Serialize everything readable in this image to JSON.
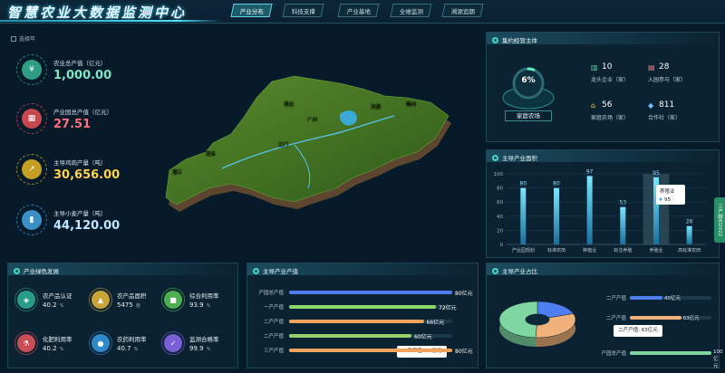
{
  "header": {
    "title": "智慧农业大数据监测中心",
    "nav": [
      "产业分布",
      "科技支撑",
      "产业基地",
      "全维监测",
      "溯源追期"
    ]
  },
  "filter": {
    "label": "选择年"
  },
  "stats": [
    {
      "label": "农业总产值（亿元）",
      "value": "1,000.00",
      "color": "#7ee7c4",
      "icon_color": "#2f9d82",
      "icon": "yuan-icon"
    },
    {
      "label": "产业园总产值（亿元）",
      "value": "27.51",
      "color": "#ff6f7d",
      "icon_color": "#c7474f",
      "icon": "building-icon"
    },
    {
      "label": "主导鸡肉产量（吨）",
      "value": "30,656.00",
      "color": "#ffd24d",
      "icon_color": "#c59e24",
      "icon": "trend-icon"
    },
    {
      "label": "主导小麦产量（吨）",
      "value": "44,120.00",
      "color": "#bfe6ff",
      "icon_color": "#3b8fc7",
      "icon": "bar-icon"
    }
  ],
  "map": {
    "cities": [
      "清远",
      "河源",
      "梅州",
      "广州",
      "江门",
      "茂名",
      "湛江"
    ]
  },
  "jiyue": {
    "title": "集约经营主体",
    "gauge_value": "6%",
    "gauge_fraction": 0.06,
    "gauge_label": "家庭农场",
    "items": [
      {
        "icon": "enterprise-icon",
        "value": "10",
        "label": "龙头企业（家）",
        "color": "#5fd3a7"
      },
      {
        "icon": "park-icon",
        "value": "28",
        "label": "入园参与（家）",
        "color": "#ff7a86"
      },
      {
        "icon": "farm-icon",
        "value": "56",
        "label": "家庭农场（家）",
        "color": "#ffcd3c"
      },
      {
        "icon": "coop-icon",
        "value": "811",
        "label": "合作社（家）",
        "color": "#6fc3ff"
      }
    ]
  },
  "mianji": {
    "title": "主导产业面积",
    "tooltip": {
      "name": "养殖业",
      "value": "95"
    }
  },
  "green": {
    "title": "产业绿色发展",
    "items": [
      {
        "icon": "shield-icon",
        "label": "农产品认证",
        "value": "40.2",
        "unit": "%",
        "color": "#2a9d8a"
      },
      {
        "icon": "area-icon",
        "label": "农产品面积",
        "value": "5475",
        "unit": "亩",
        "color": "#c9a43a"
      },
      {
        "icon": "cube-icon",
        "label": "综合利用率",
        "value": "93.9",
        "unit": "%",
        "color": "#4caf50"
      },
      {
        "icon": "flask-icon",
        "label": "化肥利用率",
        "value": "40.2",
        "unit": "%",
        "color": "#c94d55"
      },
      {
        "icon": "drop-icon",
        "label": "农药利用率",
        "value": "40.7",
        "unit": "%",
        "color": "#2e8bc9"
      },
      {
        "icon": "check-icon",
        "label": "监测合格率",
        "value": "99.9",
        "unit": "%",
        "color": "#7b5fd6"
      }
    ]
  },
  "output": {
    "title": "主导产业产值",
    "tooltip": "二产产值: 80亿元"
  },
  "share": {
    "title": "主导产业占比",
    "tooltip": "二产产值: 63亿元"
  },
  "side_tab": "三产融合2022",
  "chart_data": [
    {
      "type": "bar",
      "title": "主导产业面积",
      "categories": [
        "产业园规划",
        "标准农田",
        "种植业",
        "标注养殖",
        "养殖业",
        "高标准农田"
      ],
      "values": [
        80,
        80,
        97,
        53,
        95,
        26
      ],
      "ylim": [
        0,
        100
      ],
      "yticks": [
        0,
        20,
        40,
        60,
        80,
        100
      ]
    },
    {
      "type": "bar",
      "title": "主导产业产值",
      "orientation": "horizontal",
      "categories": [
        "产园总产值",
        "一产产值",
        "二产产值",
        "二产产值",
        "三产产值"
      ],
      "values": [
        80,
        72,
        66,
        60,
        80
      ],
      "value_labels": [
        "80亿元",
        "72亿元",
        "66亿元",
        "60亿元",
        "80亿元"
      ],
      "colors": [
        "#4f7df2",
        "#8dd86d",
        "#f0a35b",
        "#9ad06c",
        "#f0a35b"
      ]
    },
    {
      "type": "pie",
      "title": "主导产业占比",
      "labels": [
        "二产产值",
        "二产产值",
        "产园总产值"
      ],
      "bar_labels": [
        "40亿元",
        "63亿元",
        "100亿元"
      ],
      "values": [
        40,
        63,
        100
      ],
      "colors": [
        "#4f7df2",
        "#f0b27a",
        "#7fd6a0"
      ]
    }
  ]
}
